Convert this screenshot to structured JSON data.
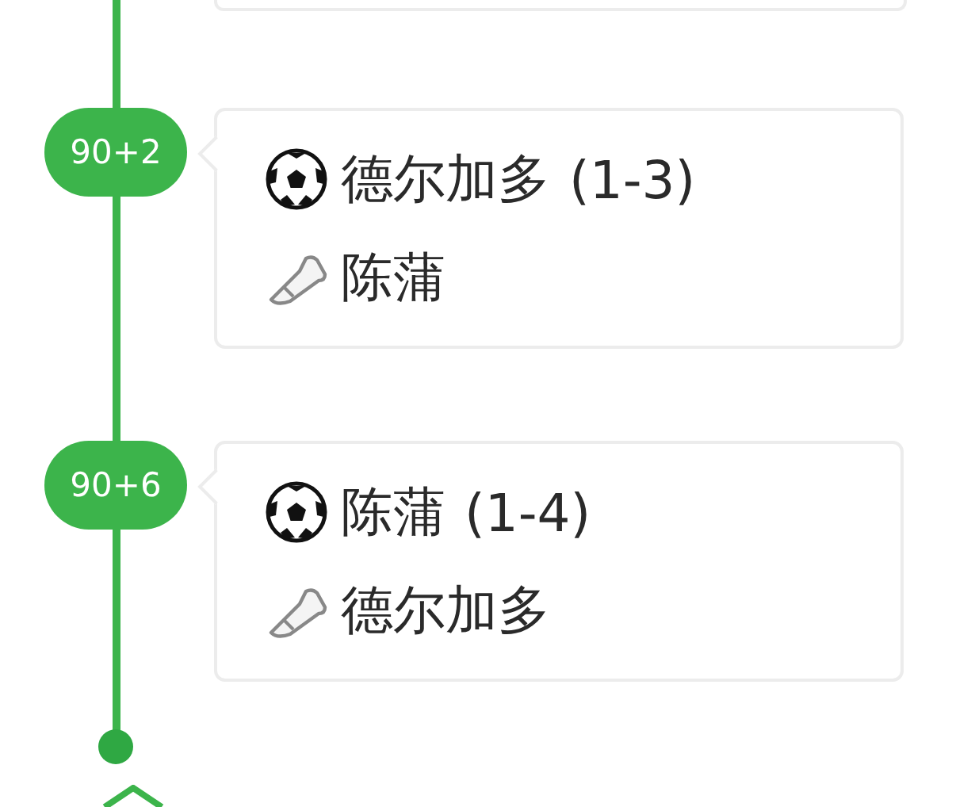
{
  "events": [
    {
      "minute": "90+2",
      "lines": [
        {
          "kind": "goal",
          "player": "德尔加多",
          "score": "(1-3)"
        },
        {
          "kind": "assist",
          "player": "陈蒲"
        }
      ]
    },
    {
      "minute": "90+6",
      "lines": [
        {
          "kind": "goal",
          "player": "陈蒲",
          "score": "(1-4)"
        },
        {
          "kind": "assist",
          "player": "德尔加多"
        }
      ]
    }
  ]
}
